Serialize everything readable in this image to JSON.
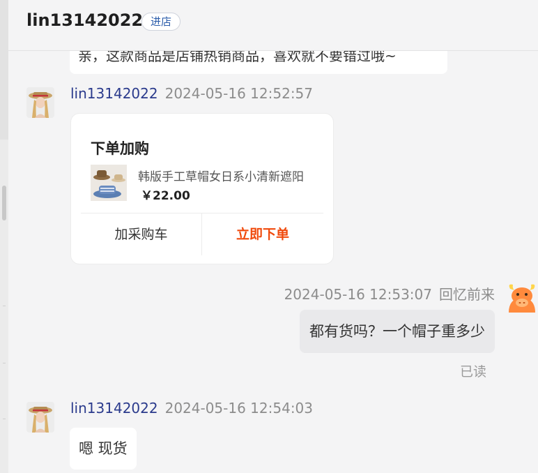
{
  "header": {
    "shop_name": "lin13142022",
    "enter_shop_label": "进店"
  },
  "messages": {
    "clipped_text": "亲，这款商品是店铺热销商品，喜欢就不要错过哦~",
    "order_card": {
      "sender": "lin13142022",
      "time": "2024-05-16 12:52:57",
      "title": "下单加购",
      "product_name": "韩版手工草帽女日系小清新遮阳",
      "price": "￥22.00",
      "add_to_cart_label": "加采购车",
      "buy_now_label": "立即下单"
    },
    "my_message": {
      "time": "2024-05-16 12:53:07",
      "sender": "回忆前来",
      "text": "都有货吗？一个帽子重多少",
      "read_status": "已读"
    },
    "reply": {
      "sender": "lin13142022",
      "time": "2024-05-16 12:54:03",
      "text": "嗯 现货"
    }
  },
  "colors": {
    "accent_orange": "#f04a0c",
    "name_blue": "#2a3a8c",
    "link_blue": "#2a5caa"
  }
}
